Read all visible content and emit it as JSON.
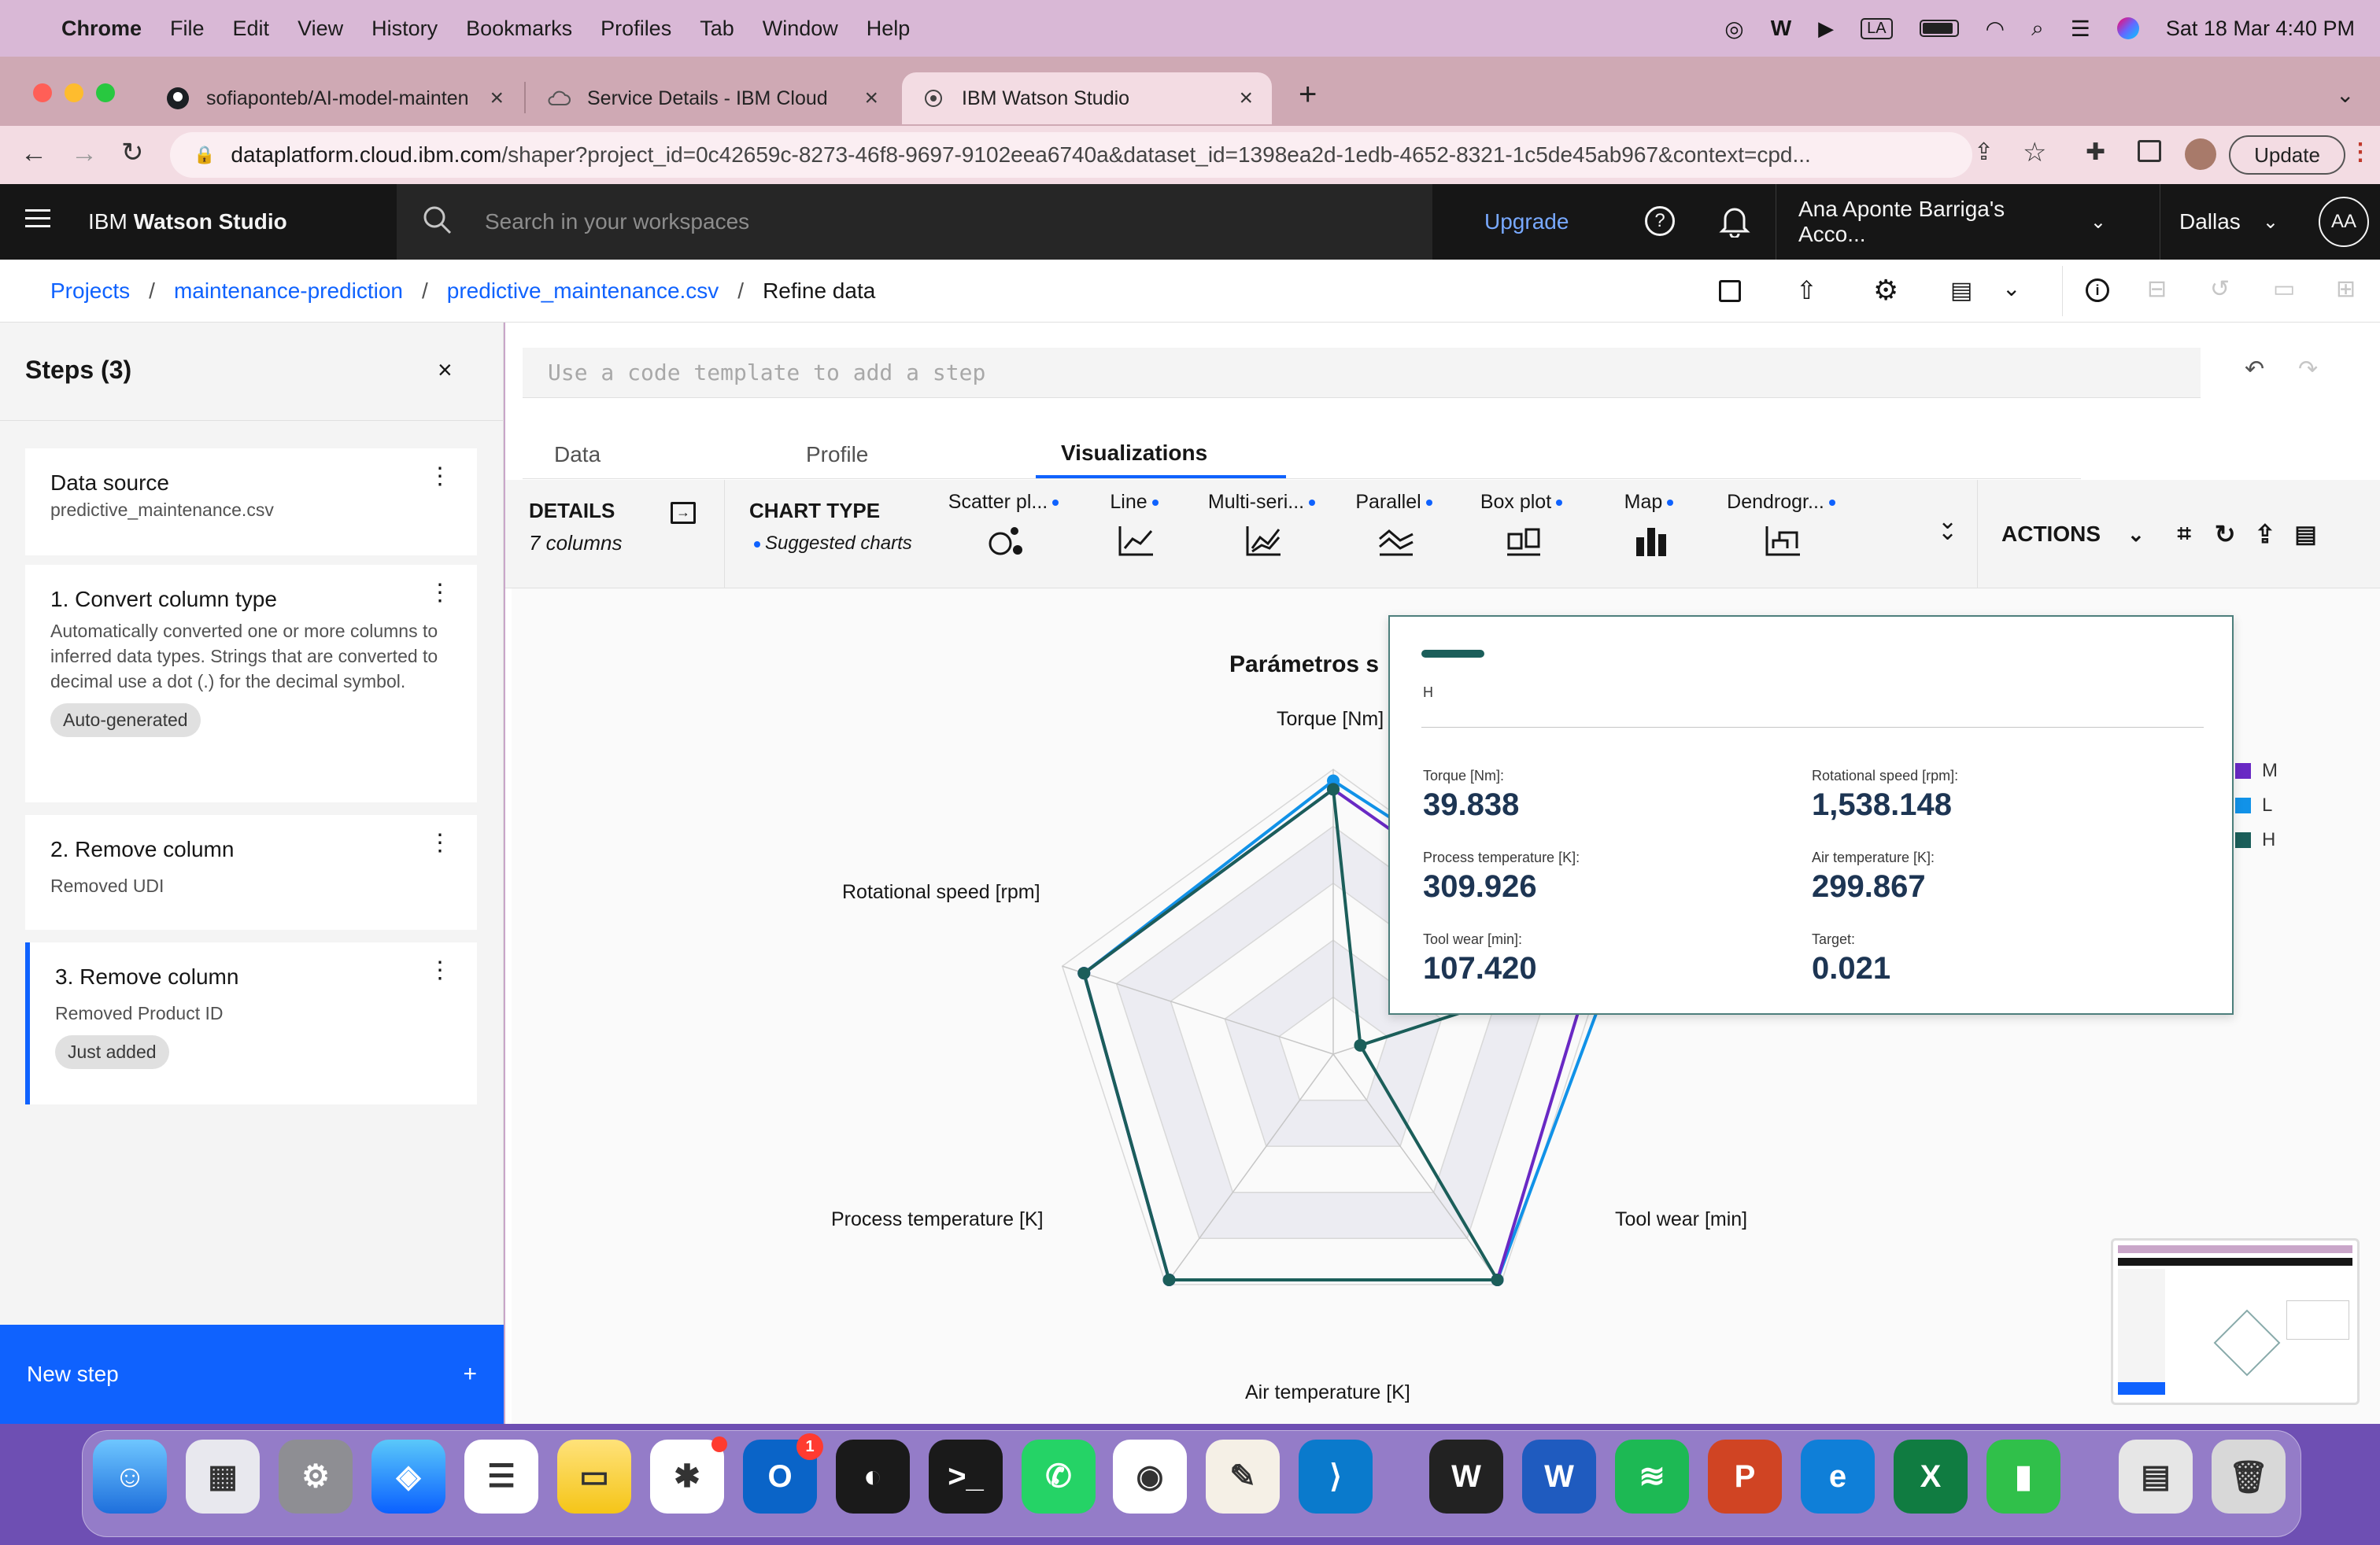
{
  "menubar": {
    "app": "Chrome",
    "items": [
      "File",
      "Edit",
      "View",
      "History",
      "Bookmarks",
      "Profiles",
      "Tab",
      "Window",
      "Help"
    ],
    "clock": "Sat 18 Mar  4:40 PM",
    "input_source": "LA"
  },
  "browser": {
    "tabs": [
      {
        "label": "sofiaponteb/AI-model-mainten"
      },
      {
        "label": "Service Details - IBM Cloud"
      },
      {
        "label": "IBM Watson Studio"
      }
    ],
    "url_host": "dataplatform.cloud.ibm.com",
    "url_path": "/shaper?project_id=0c42659c-8273-46f8-9697-9102eea6740a&dataset_id=1398ea2d-1edb-4652-8321-1c5de45ab967&context=cpd...",
    "update_label": "Update"
  },
  "header": {
    "brand_prefix": "IBM",
    "brand_product": "Watson Studio",
    "search_placeholder": "Search in your workspaces",
    "upgrade": "Upgrade",
    "account": "Ana Aponte Barriga's Acco...",
    "region": "Dallas",
    "avatar": "AA"
  },
  "breadcrumb": {
    "items": [
      "Projects",
      "maintenance-prediction",
      "predictive_maintenance.csv"
    ],
    "current": "Refine data"
  },
  "steps": {
    "title": "Steps (3)",
    "items": [
      {
        "title": "Data source",
        "desc": "predictive_maintenance.csv"
      },
      {
        "title": "1. Convert column type",
        "desc": "Automatically converted one or more columns to inferred data types. Strings that are converted to decimal use a dot (.) for the decimal symbol.",
        "tag": "Auto-generated"
      },
      {
        "title": "2. Remove column",
        "desc": "Removed UDI"
      },
      {
        "title": "3. Remove column",
        "desc": "Removed Product ID",
        "tag": "Just added"
      }
    ],
    "new_step": "New step"
  },
  "main": {
    "code_placeholder": "Use a code template to add a step",
    "tabs": [
      "Data",
      "Profile",
      "Visualizations"
    ],
    "details_label": "DETAILS",
    "details_sub": "7 columns",
    "chart_type_label": "CHART TYPE",
    "suggested": "Suggested charts",
    "chart_types": [
      "Scatter pl...",
      "Line",
      "Multi-seri...",
      "Parallel",
      "Box plot",
      "Map",
      "Dendrogr..."
    ],
    "actions": "ACTIONS"
  },
  "chart_data": {
    "type": "radar",
    "title": "Parámetros s",
    "axes": [
      "Torque [Nm]",
      "Tool wear [min]",
      "Air temperature [K]",
      "Process temperature [K]",
      "Rotational speed [rpm]"
    ],
    "series": [
      {
        "name": "M",
        "color": "#6929c4",
        "values": [
          0.93,
          0.95,
          0.98,
          0.98,
          0.92
        ]
      },
      {
        "name": "L",
        "color": "#1192e8",
        "values": [
          0.96,
          1.04,
          0.98,
          0.98,
          0.92
        ]
      },
      {
        "name": "H",
        "color": "#1b5e5a",
        "values": [
          0.93,
          0.95,
          0.98,
          0.98,
          0.92
        ]
      }
    ],
    "h_target_point": 0.1
  },
  "tooltip": {
    "series": "H",
    "color": "#1b5e5a",
    "fields": [
      {
        "label": "Torque [Nm]:",
        "value": "39.838"
      },
      {
        "label": "Rotational speed [rpm]:",
        "value": "1,538.148"
      },
      {
        "label": "Process temperature [K]:",
        "value": "309.926"
      },
      {
        "label": "Air temperature [K]:",
        "value": "299.867"
      },
      {
        "label": "Tool wear [min]:",
        "value": "107.420"
      },
      {
        "label": "Target:",
        "value": "0.021"
      }
    ]
  },
  "dock": {
    "apps": [
      "Finder",
      "Launchpad",
      "System Settings",
      "Safari",
      "Reminders",
      "Notes",
      "Slack",
      "Outlook",
      "Camera",
      "Terminal",
      "WhatsApp",
      "Chrome",
      "TextEdit",
      "VS Code",
      "Webex",
      "Word",
      "Spotify",
      "PowerPoint",
      "Edge",
      "Excel",
      "Numbers",
      "Preview",
      "Trash"
    ],
    "outlook_badge": "1"
  }
}
